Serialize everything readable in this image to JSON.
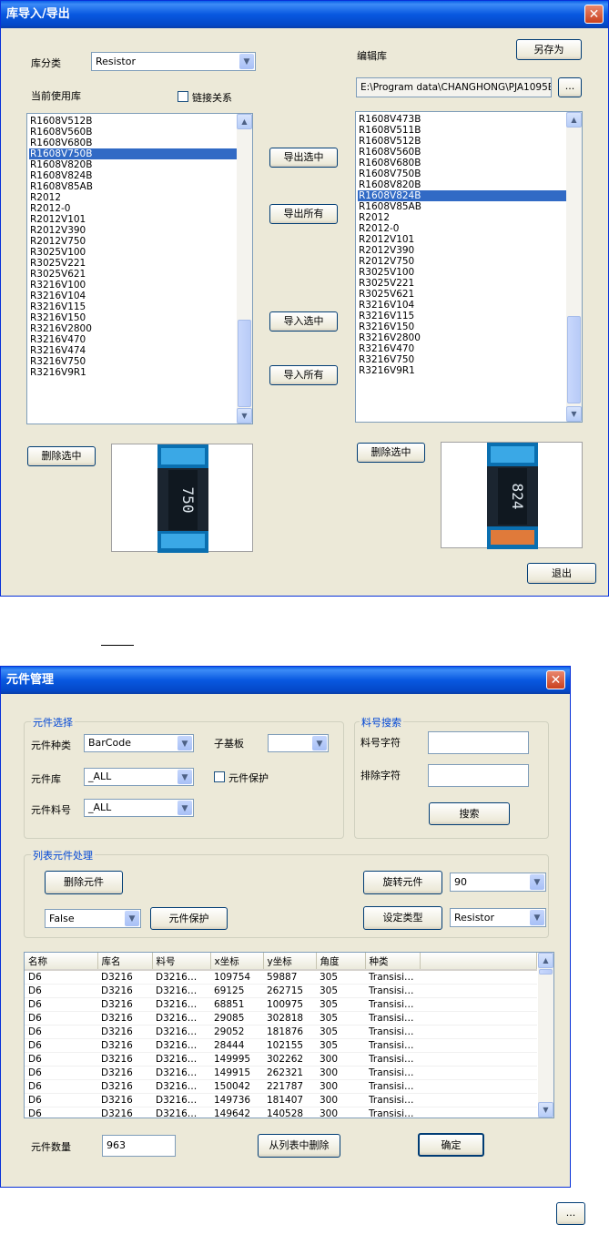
{
  "dialog1": {
    "title": "库导入/导出",
    "close_glyph": "✕",
    "lib_category_label": "库分类",
    "lib_category_value": "Resistor",
    "edit_lib_label": "编辑库",
    "save_as_label": "另存为",
    "path_value": "E:\\Program data\\CHANGHONG\\PJA1095E",
    "browse_label": "...",
    "current_lib_label": "当前使用库",
    "link_relation_label": "链接关系",
    "left_list": [
      "R1608V512B",
      "R1608V560B",
      "R1608V680B",
      "R1608V750B",
      "R1608V820B",
      "R1608V824B",
      "R1608V85AB",
      "R2012",
      "R2012-0",
      "R2012V101",
      "R2012V390",
      "R2012V750",
      "R3025V100",
      "R3025V221",
      "R3025V621",
      "R3216V100",
      "R3216V104",
      "R3216V115",
      "R3216V150",
      "R3216V2800",
      "R3216V470",
      "R3216V474",
      "R3216V750",
      "R3216V9R1"
    ],
    "left_selected": 3,
    "right_list": [
      "R1608V473B",
      "R1608V511B",
      "R1608V512B",
      "R1608V560B",
      "R1608V680B",
      "R1608V750B",
      "R1608V820B",
      "R1608V824B",
      "R1608V85AB",
      "R2012",
      "R2012-0",
      "R2012V101",
      "R2012V390",
      "R2012V750",
      "R3025V100",
      "R3025V221",
      "R3025V621",
      "R3216V104",
      "R3216V115",
      "R3216V150",
      "R3216V2800",
      "R3216V470",
      "R3216V750",
      "R3216V9R1"
    ],
    "right_selected": 7,
    "export_selected_label": "导出选中",
    "export_all_label": "导出所有",
    "import_selected_label": "导入选中",
    "import_all_label": "导入所有",
    "delete_selected_left_label": "删除选中",
    "delete_selected_right_label": "删除选中",
    "photo_left_marking": "750",
    "photo_right_marking": "824",
    "exit_label": "退出"
  },
  "dialog2": {
    "title": "元件管理",
    "close_glyph": "✕",
    "group_select_label": "元件选择",
    "comp_type_label": "元件种类",
    "comp_type_value": "BarCode",
    "sub_board_label": "子基板",
    "sub_board_value": "",
    "comp_lib_label": "元件库",
    "comp_lib_value": "_ALL",
    "comp_protect_check_label": "元件保护",
    "comp_part_label": "元件料号",
    "comp_part_value": "_ALL",
    "group_search_label": "料号搜索",
    "part_char_label": "料号字符",
    "part_char_value": "",
    "exclude_char_label": "排除字符",
    "exclude_char_value": "",
    "search_label": "搜索",
    "group_process_label": "列表元件处理",
    "delete_comp_label": "删除元件",
    "rotate_comp_label": "旋转元件",
    "rotate_value": "90",
    "protect_value": "False",
    "comp_protect_button_label": "元件保护",
    "set_type_label": "设定类型",
    "set_type_value": "Resistor",
    "columns": [
      "名称",
      "库名",
      "料号",
      "x坐标",
      "y坐标",
      "角度",
      "种类"
    ],
    "rows": [
      [
        "D6",
        "D3216",
        "D3216…",
        "109754",
        "59887",
        "305",
        "Transisi…"
      ],
      [
        "D6",
        "D3216",
        "D3216…",
        "69125",
        "262715",
        "305",
        "Transisi…"
      ],
      [
        "D6",
        "D3216",
        "D3216…",
        "68851",
        "100975",
        "305",
        "Transisi…"
      ],
      [
        "D6",
        "D3216",
        "D3216…",
        "29085",
        "302818",
        "305",
        "Transisi…"
      ],
      [
        "D6",
        "D3216",
        "D3216…",
        "29052",
        "181876",
        "305",
        "Transisi…"
      ],
      [
        "D6",
        "D3216",
        "D3216…",
        "28444",
        "102155",
        "305",
        "Transisi…"
      ],
      [
        "D6",
        "D3216",
        "D3216…",
        "149995",
        "302262",
        "300",
        "Transisi…"
      ],
      [
        "D6",
        "D3216",
        "D3216…",
        "149915",
        "262321",
        "300",
        "Transisi…"
      ],
      [
        "D6",
        "D3216",
        "D3216…",
        "150042",
        "221787",
        "300",
        "Transisi…"
      ],
      [
        "D6",
        "D3216",
        "D3216…",
        "149736",
        "181407",
        "300",
        "Transisi…"
      ],
      [
        "D6",
        "D3216",
        "D3216…",
        "149642",
        "140528",
        "300",
        "Transisi…"
      ]
    ],
    "count_label": "元件数量",
    "count_value": "963",
    "remove_from_list_label": "从列表中删除",
    "ok_label": "确定"
  },
  "floating_browse_label": "...",
  "icons": {
    "dropdown": "chevron-down-icon",
    "scroll_up": "arrow-up-icon",
    "scroll_down": "arrow-down-icon",
    "close": "close-icon"
  },
  "colors": {
    "title_bar": "#0858e0",
    "window_bg": "#ece9d8",
    "selection": "#316ac5",
    "group_label": "#0046d5"
  }
}
